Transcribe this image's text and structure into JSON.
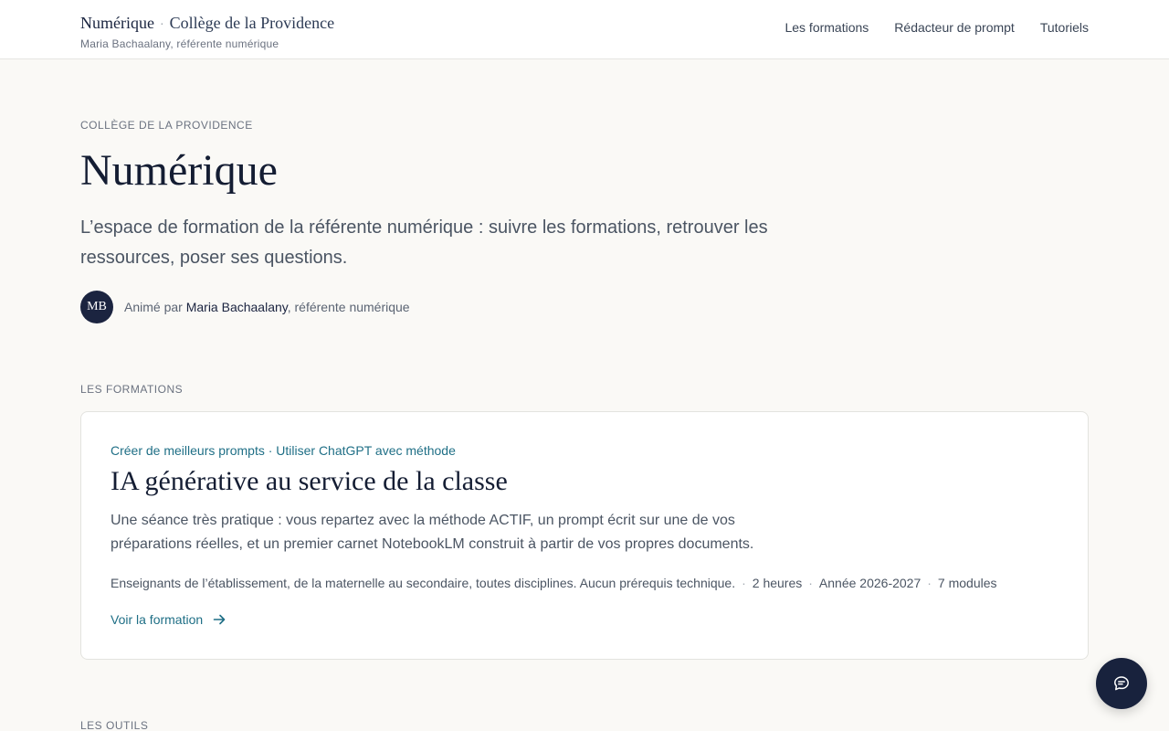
{
  "header": {
    "brand_name": "Numérique",
    "brand_separator": "·",
    "brand_school": "Collège de la Providence",
    "brand_subtitle": "Maria Bachaalany, référente numérique",
    "nav": [
      "Les formations",
      "Rédacteur de prompt",
      "Tutoriels"
    ]
  },
  "hero": {
    "eyebrow": "Collège de la Providence",
    "title": "Numérique",
    "lead": "L’espace de formation de la référente numérique : suivre les formations, retrouver les ressources, poser ses questions.",
    "avatar_initials": "MB",
    "author_prefix": "Animé par ",
    "author_name": "Maria Bachaalany",
    "author_suffix": ", référente numérique"
  },
  "formations": {
    "section_label": "Les formations",
    "card": {
      "kicker": "Créer de meilleurs prompts · Utiliser ChatGPT avec méthode",
      "title": "IA générative au service de la classe",
      "description": "Une séance très pratique : vous repartez avec la méthode ACTIF, un prompt écrit sur une de vos préparations réelles, et un premier carnet NotebookLM construit à partir de vos propres documents.",
      "audience": "Enseignants de l’établissement, de la maternelle au secondaire, toutes disciplines. Aucun prérequis technique.",
      "duration": "2 heures",
      "year": "Année 2026-2027",
      "modules": "7 modules",
      "meta_separator": "·",
      "link_label": "Voir la formation"
    }
  },
  "tools": {
    "section_label": "Les outils"
  },
  "icons": {
    "arrow": "arrow-right-icon",
    "chat": "chat-bubble-icon"
  },
  "colors": {
    "accent": "#1f6f86",
    "dark": "#18223d",
    "background": "#faf9f6"
  }
}
